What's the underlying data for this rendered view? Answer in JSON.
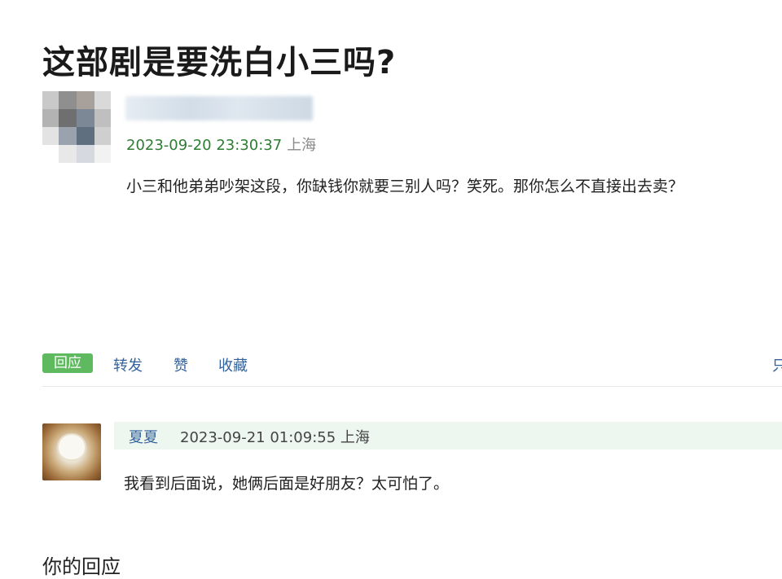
{
  "post": {
    "title": "这部剧是要洗白小三吗?",
    "time": "2023-09-20 23:30:37",
    "location": "上海",
    "body": "小三和他弟弟吵架这段，你缺钱你就要三别人吗？笑死。那你怎么不直接出去卖？"
  },
  "actions": {
    "reply": "回应",
    "repost": "转发",
    "like": "赞",
    "collect": "收藏",
    "only": "只"
  },
  "comment": {
    "author": "夏夏",
    "time": "2023-09-21 01:09:55",
    "location": "上海",
    "body": "我看到后面说，她俩后面是好朋友？太可怕了。"
  },
  "your_reply_heading": "你的回应",
  "colors": {
    "reply_button": "#5fba5f",
    "link": "#33629a",
    "timestamp_green": "#2e7d32",
    "comment_header_bg": "#eef6f0"
  }
}
